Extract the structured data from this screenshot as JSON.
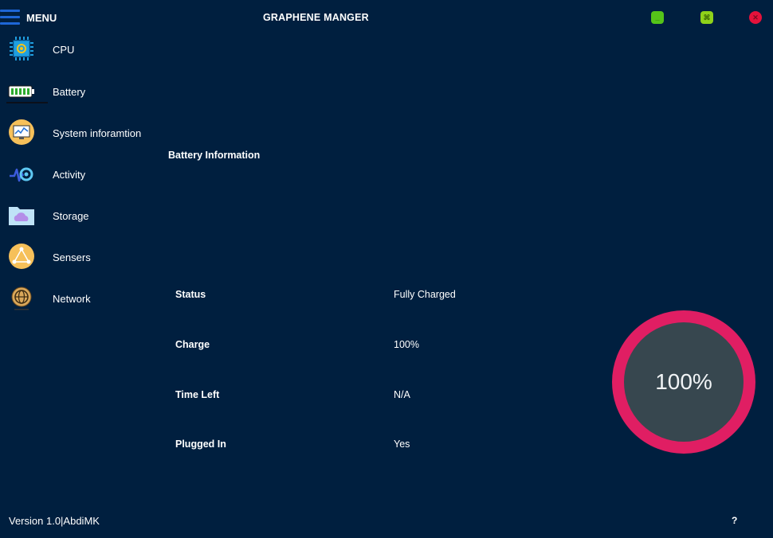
{
  "header": {
    "menu_label": "MENU",
    "app_title": "GRAPHENE  MANGER",
    "minimize_label": "_",
    "maximize_label": "⌘",
    "close_label": "✕"
  },
  "sidebar": {
    "items": [
      {
        "label": "CPU",
        "icon": "cpu-icon"
      },
      {
        "label": "Battery",
        "icon": "battery-icon"
      },
      {
        "label": "System inforamtion",
        "icon": "monitor-icon"
      },
      {
        "label": "Activity",
        "icon": "activity-icon"
      },
      {
        "label": "Storage",
        "icon": "cloud-folder-icon"
      },
      {
        "label": "Sensers",
        "icon": "sensor-network-icon"
      },
      {
        "label": "Network",
        "icon": "globe-icon"
      }
    ],
    "active": "Battery"
  },
  "main": {
    "section_title": "Battery Information",
    "rows": [
      {
        "label": "Status",
        "value": "Fully Charged"
      },
      {
        "label": "Charge",
        "value": "100%"
      },
      {
        "label": "Time Left",
        "value": "N/A"
      },
      {
        "label": "Plugged In",
        "value": "Yes"
      }
    ],
    "gauge": {
      "text": "100%",
      "value": 1.0,
      "ring_color": "#e01e63",
      "inner_color": "#37474f"
    }
  },
  "footer": {
    "version": "Version 1.0|AbdiMK",
    "help": "?"
  },
  "colors": {
    "background": "#001f3f",
    "accent": "#1e66d6"
  }
}
